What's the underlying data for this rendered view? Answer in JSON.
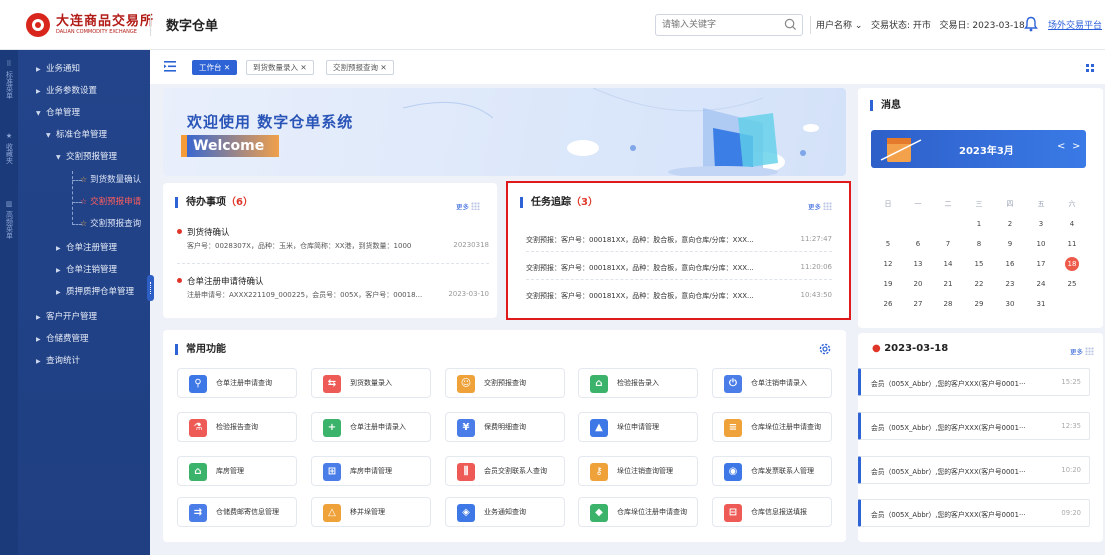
{
  "header": {
    "logo_cn": "大连商品交易所",
    "logo_en": "DALIAN COMMODITY EXCHANGE",
    "app_title": "数字仓单",
    "search_placeholder": "请输入关键字",
    "user_name": "用户名称",
    "trade_status": "交易状态: 开市",
    "trade_day": "交易日: 2023-03-18",
    "otc_link": "场外交易平台"
  },
  "strip": {
    "groups": [
      "标准菜单",
      "收藏夹",
      "高频菜单"
    ]
  },
  "sidebar": {
    "items": [
      {
        "label": "业务通知",
        "caret": "▶"
      },
      {
        "label": "业务参数设置",
        "caret": "▶"
      },
      {
        "label": "仓单管理",
        "caret": "▼"
      },
      {
        "label": "标准仓单管理",
        "caret": "▼"
      },
      {
        "label": "交割预报管理",
        "caret": "▼"
      },
      {
        "label": "到货数量确认"
      },
      {
        "label": "交割预报申请"
      },
      {
        "label": "交割预报查询"
      },
      {
        "label": "仓单注册管理",
        "caret": "▶"
      },
      {
        "label": "仓单注销管理",
        "caret": "▶"
      },
      {
        "label": "质押质押仓单管理",
        "caret": "▶"
      },
      {
        "label": "客户开户管理",
        "caret": "▶"
      },
      {
        "label": "仓储费管理",
        "caret": "▶"
      },
      {
        "label": "查询统计",
        "caret": "▶"
      }
    ]
  },
  "tabs": [
    {
      "label": "工作台 ✕",
      "active": true
    },
    {
      "label": "到货数量录入 ✕",
      "active": false
    },
    {
      "label": "交割预报查询 ✕",
      "active": false
    }
  ],
  "banner": {
    "title": "欢迎使用  数字仓单系统",
    "welcome": "Welcome"
  },
  "todo": {
    "title": "待办事项",
    "count": "（6）",
    "more": "更多",
    "items": [
      {
        "head": "到货待确认",
        "sub": "客户号：0028307X，品种：玉米，仓库简称：XX港，到货数量：1000",
        "date": "20230318"
      },
      {
        "head": "仓单注册申请待确认",
        "sub": "注册申请号：AXXX221109_000225，会员号：005X，客户号：00018...",
        "date": "2023-03-10"
      }
    ]
  },
  "tasks": {
    "title": "任务追踪",
    "count": "（3）",
    "more": "更多",
    "items": [
      {
        "text": "交割预报：客户号：000181XX，品种：胶合板，意向仓库/分库：XXX...",
        "time": "11:27:47"
      },
      {
        "text": "交割预报：客户号：000181XX，品种：胶合板，意向仓库/分库：XXX...",
        "time": "11:20:06"
      },
      {
        "text": "交割预报：客户号：000181XX，品种：胶合板，意向仓库/分库：XXX...",
        "time": "10:43:50"
      }
    ]
  },
  "common": {
    "title": "常用功能",
    "buttons": [
      {
        "label": "仓单注册申请查询",
        "icon": "search-icon",
        "color": "#3d78e6",
        "glyph": "⚲"
      },
      {
        "label": "到货数量录入",
        "icon": "transfer-icon",
        "color": "#ee5a55",
        "glyph": "⇆"
      },
      {
        "label": "交割预报查询",
        "icon": "person-icon",
        "color": "#f0a23a",
        "glyph": "☺"
      },
      {
        "label": "检验报告录入",
        "icon": "home-icon",
        "color": "#3bb36a",
        "glyph": "⌂"
      },
      {
        "label": "仓单注销申请录入",
        "icon": "power-icon",
        "color": "#4a7de8",
        "glyph": "⏻"
      },
      {
        "label": "检验报告查询",
        "icon": "flask-icon",
        "color": "#ee5a55",
        "glyph": "⚗"
      },
      {
        "label": "仓单注册申请录入",
        "icon": "plus-icon",
        "color": "#3bb36a",
        "glyph": "+"
      },
      {
        "label": "保费明细查询",
        "icon": "yuan-icon",
        "color": "#4a7de8",
        "glyph": "¥"
      },
      {
        "label": "垛位申请管理",
        "icon": "triangle-icon",
        "color": "#3d78e6",
        "glyph": "▲"
      },
      {
        "label": "仓库垛位注册申请查询",
        "icon": "list-icon",
        "color": "#f0a23a",
        "glyph": "≡"
      },
      {
        "label": "库房管理",
        "icon": "house-icon",
        "color": "#3bb36a",
        "glyph": "⌂"
      },
      {
        "label": "库房申请管理",
        "icon": "grid-icon",
        "color": "#4a7de8",
        "glyph": "⊞"
      },
      {
        "label": "会员交割联系人查询",
        "icon": "bars-icon",
        "color": "#ee5a55",
        "glyph": "⫼"
      },
      {
        "label": "垛位注销查询管理",
        "icon": "key-icon",
        "color": "#f0a23a",
        "glyph": "⚷"
      },
      {
        "label": "仓库发票联系人管理",
        "icon": "contact-icon",
        "color": "#3d78e6",
        "glyph": "◉"
      },
      {
        "label": "仓储费邮寄信息管理",
        "icon": "send-icon",
        "color": "#4a7de8",
        "glyph": "⇉"
      },
      {
        "label": "移并垛管理",
        "icon": "warning-icon",
        "color": "#f0a23a",
        "glyph": "△"
      },
      {
        "label": "业务通知查询",
        "icon": "location-icon",
        "color": "#3d78e6",
        "glyph": "◈"
      },
      {
        "label": "仓库垛位注册申请查询",
        "icon": "layers-icon",
        "color": "#3bb36a",
        "glyph": "◆"
      },
      {
        "label": "仓库信息报送填报",
        "icon": "table-icon",
        "color": "#ee5a55",
        "glyph": "⊟"
      }
    ]
  },
  "messages_panel": {
    "title": "消息",
    "month": "2023年3月",
    "prev": "<",
    "next": ">",
    "weekdays": [
      "日",
      "一",
      "二",
      "三",
      "四",
      "五",
      "六"
    ],
    "today": "18",
    "date_title": "2023-03-18",
    "more": "更多",
    "messages": [
      {
        "text": "会员（005X_Abbr）,您的客户XXX(客户号0001···",
        "time": "15:25"
      },
      {
        "text": "会员（005X_Abbr）,您的客户XXX(客户号0001···",
        "time": "12:35"
      },
      {
        "text": "会员（005X_Abbr）,您的客户XXX(客户号0001···",
        "time": "10:20"
      },
      {
        "text": "会员（005X_Abbr）,您的客户XXX(客户号0001···",
        "time": "09:20"
      }
    ]
  },
  "colors": {
    "accent": "#2e63d6",
    "sidebar": "#23448a",
    "alert": "#e0362a",
    "highlight_frame": "#e0191c"
  }
}
